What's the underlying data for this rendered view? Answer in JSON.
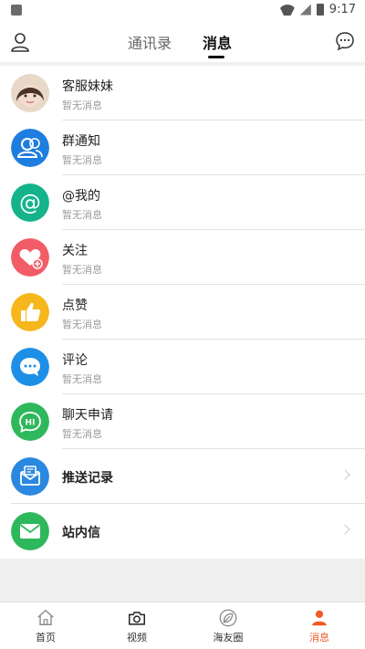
{
  "status_bar": {
    "time": "9:17"
  },
  "header": {
    "tabs": [
      {
        "label": "通讯录"
      },
      {
        "label": "消息"
      }
    ]
  },
  "messages": [
    {
      "title": "客服妹妹",
      "subtitle": "暂无消息",
      "icon": "avatar-photo"
    },
    {
      "title": "群通知",
      "subtitle": "暂无消息",
      "icon": "group-icon",
      "color": "#1f7de0"
    },
    {
      "title": "@我的",
      "subtitle": "暂无消息",
      "icon": "at-icon",
      "color": "#14b38c"
    },
    {
      "title": "关注",
      "subtitle": "暂无消息",
      "icon": "heart-plus-icon",
      "color": "#f25c67"
    },
    {
      "title": "点赞",
      "subtitle": "暂无消息",
      "icon": "thumbs-up-icon",
      "color": "#f6b71d"
    },
    {
      "title": "评论",
      "subtitle": "暂无消息",
      "icon": "comment-icon",
      "color": "#1e8fe6"
    },
    {
      "title": "聊天申请",
      "subtitle": "暂无消息",
      "icon": "hi-chat-icon",
      "color": "#2eb85c"
    }
  ],
  "extras": [
    {
      "title": "推送记录",
      "icon": "push-mail-icon",
      "color": "#2b88e0"
    },
    {
      "title": "站内信",
      "icon": "mail-icon",
      "color": "#2eb85c"
    }
  ],
  "bottom_nav": [
    {
      "label": "首页",
      "icon": "home-icon"
    },
    {
      "label": "视频",
      "icon": "camera-icon"
    },
    {
      "label": "海友圈",
      "icon": "leaf-icon"
    },
    {
      "label": "消息",
      "icon": "person-icon",
      "active": true
    }
  ],
  "colors": {
    "accent": "#f05a28"
  }
}
